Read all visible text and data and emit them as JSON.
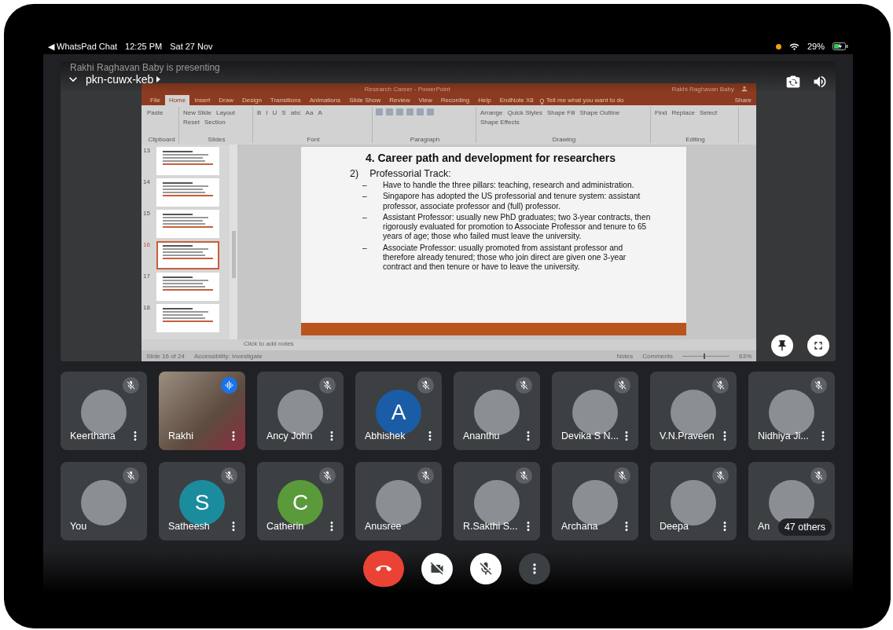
{
  "status_bar": {
    "back_app": "◀ WhatsPad Chat",
    "time": "12:25 PM",
    "date": "Sat 27 Nov",
    "battery": "29%"
  },
  "presentation": {
    "presenter": "Rakhi Raghavan Baby is presenting",
    "meeting_code": "pkn-cuwx-keb",
    "powerpoint": {
      "title": "Research Career - PowerPoint",
      "user": "Rakhi Raghavan Baby",
      "tabs": [
        {
          "label": "File",
          "selected": false
        },
        {
          "label": "Home",
          "selected": true
        },
        {
          "label": "Insert",
          "selected": false
        },
        {
          "label": "Draw",
          "selected": false
        },
        {
          "label": "Design",
          "selected": false
        },
        {
          "label": "Transitions",
          "selected": false
        },
        {
          "label": "Animations",
          "selected": false
        },
        {
          "label": "Slide Show",
          "selected": false
        },
        {
          "label": "Review",
          "selected": false
        },
        {
          "label": "View",
          "selected": false
        },
        {
          "label": "Recording",
          "selected": false
        },
        {
          "label": "Help",
          "selected": false
        },
        {
          "label": "EndNote X8",
          "selected": false
        }
      ],
      "tell_me": "Tell me what you want to do",
      "share": "Share",
      "ribbon_groups": [
        {
          "label": "Clipboard",
          "items": [
            "Paste"
          ]
        },
        {
          "label": "Slides",
          "items": [
            "New Slide",
            "Layout",
            "Reset",
            "Section"
          ]
        },
        {
          "label": "Font",
          "items": [
            "B",
            "I",
            "U",
            "S",
            "abc",
            "Aa",
            "A"
          ]
        },
        {
          "label": "Paragraph"
        },
        {
          "label": "Drawing",
          "items": [
            "Arrange",
            "Quick Styles",
            "Shape Fill",
            "Shape Outline",
            "Shape Effects"
          ]
        },
        {
          "label": "Editing",
          "items": [
            "Find",
            "Replace",
            "Select"
          ]
        }
      ],
      "thumbnails": [
        {
          "number": "13",
          "selected": false
        },
        {
          "number": "14",
          "selected": false
        },
        {
          "number": "15",
          "selected": false
        },
        {
          "number": "16",
          "selected": true
        },
        {
          "number": "17",
          "selected": false
        },
        {
          "number": "18",
          "selected": false
        }
      ],
      "slide": {
        "title": "4. Career path and development for researchers",
        "item_number": "2)",
        "item_title": "Professorial Track:",
        "bullets": [
          {
            "marker": "–",
            "text": "Have to handle the three pillars: teaching, research and administration."
          },
          {
            "marker": "–",
            "text": "Singapore has adopted the US professorial and tenure system: assistant professor, associate professor and (full) professor."
          },
          {
            "marker": "–",
            "text": "Assistant Professor: usually new PhD graduates; two 3-year contracts, then rigorously evaluated for promotion to Associate Professor and tenure to 65 years of age; those who failed must leave the university."
          },
          {
            "marker": "–",
            "text": "Associate Professor: usually promoted from assistant professor and therefore already tenured; those who join direct are given one 3-year contract and then tenure or have to leave the university."
          }
        ]
      },
      "notes_placeholder": "Click to add notes",
      "status": {
        "slide_count": "Slide 16 of 24",
        "accessibility": "Accessibility: Investigate",
        "notes": "Notes",
        "comments": "Comments",
        "zoom_slider": {
          "level": 0.47
        },
        "zoom": "63%"
      }
    }
  },
  "participants": [
    {
      "name": "Keerthana",
      "muted": true,
      "avatar": {
        "kind": "photo"
      },
      "speaking": false,
      "menu": true
    },
    {
      "name": "Rakhi",
      "muted": false,
      "avatar": {
        "kind": "video"
      },
      "speaking": true,
      "menu": true
    },
    {
      "name": "Ancy John",
      "muted": true,
      "avatar": {
        "kind": "photo"
      },
      "speaking": false,
      "menu": true
    },
    {
      "name": "Abhishek",
      "muted": true,
      "avatar": {
        "kind": "letter",
        "letter": "A",
        "color": "#1a5ca6"
      },
      "speaking": false,
      "menu": true
    },
    {
      "name": "Ananthu",
      "muted": true,
      "avatar": {
        "kind": "photo"
      },
      "speaking": false,
      "menu": true
    },
    {
      "name": "Devika S N...",
      "muted": true,
      "avatar": {
        "kind": "photo"
      },
      "speaking": false,
      "menu": true
    },
    {
      "name": "V.N.Praveen",
      "muted": true,
      "avatar": {
        "kind": "photo"
      },
      "speaking": false,
      "menu": true
    },
    {
      "name": "Nidhiya Ji...",
      "muted": true,
      "avatar": {
        "kind": "photo"
      },
      "speaking": false,
      "menu": true
    },
    {
      "name": "You",
      "muted": true,
      "avatar": {
        "kind": "photo"
      },
      "speaking": false,
      "menu": false
    },
    {
      "name": "Satheesh",
      "muted": true,
      "avatar": {
        "kind": "letter",
        "letter": "S",
        "color": "#1b8c9e"
      },
      "speaking": false,
      "menu": true
    },
    {
      "name": "Catherin",
      "muted": true,
      "avatar": {
        "kind": "letter",
        "letter": "C",
        "color": "#5b9a3a"
      },
      "speaking": false,
      "menu": true
    },
    {
      "name": "Anusree",
      "muted": true,
      "avatar": {
        "kind": "photo"
      },
      "speaking": false,
      "menu": false
    },
    {
      "name": "R.Sakthi S...",
      "muted": true,
      "avatar": {
        "kind": "photo"
      },
      "speaking": false,
      "menu": true
    },
    {
      "name": "Archana",
      "muted": true,
      "avatar": {
        "kind": "photo"
      },
      "speaking": false,
      "menu": true
    },
    {
      "name": "Deepa",
      "muted": true,
      "avatar": {
        "kind": "photo"
      },
      "speaking": false,
      "menu": true
    },
    {
      "name": "An",
      "muted": true,
      "avatar": {
        "kind": "photo"
      },
      "speaking": false,
      "menu": false,
      "overflow": "47 others"
    }
  ],
  "controls": [
    {
      "kind": "end"
    },
    {
      "kind": "camera"
    },
    {
      "kind": "mic"
    },
    {
      "kind": "more"
    }
  ]
}
